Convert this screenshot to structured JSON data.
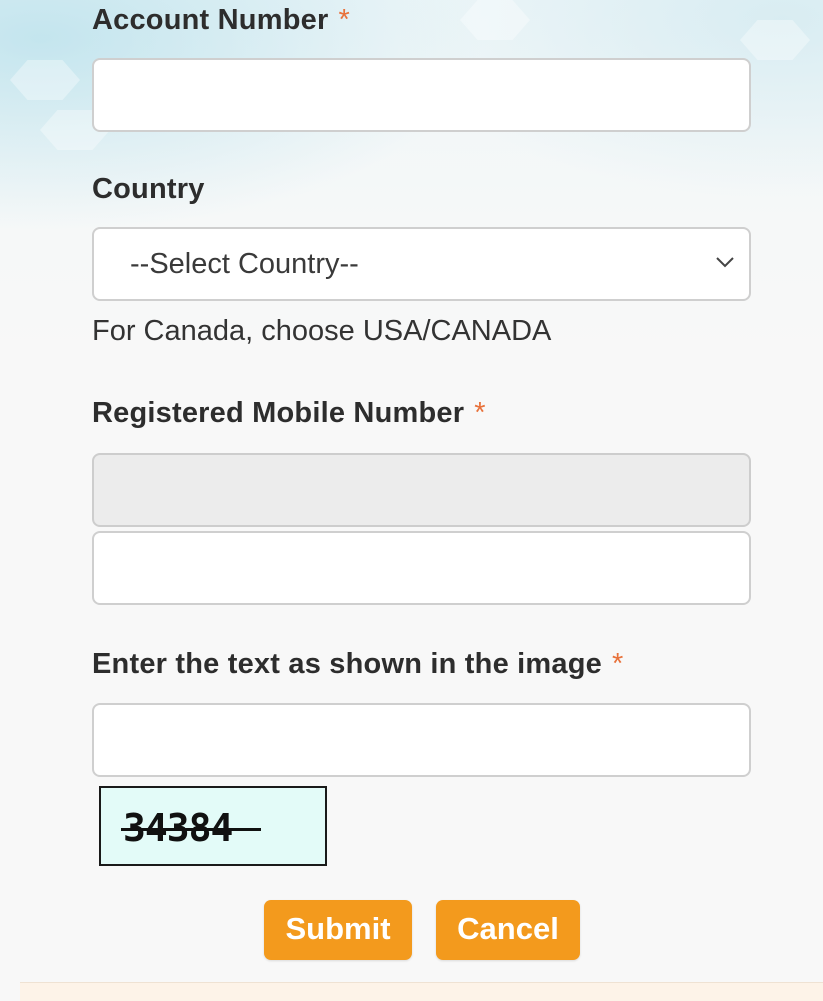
{
  "form": {
    "account_number": {
      "label": "Account Number",
      "required_mark": "*",
      "value": ""
    },
    "country": {
      "label": "Country",
      "selected": "--Select Country--",
      "hint": "For Canada, choose USA/CANADA"
    },
    "mobile": {
      "label": "Registered Mobile Number",
      "required_mark": "*",
      "code_value": "",
      "value": ""
    },
    "captcha": {
      "label": "Enter the text as shown in the image",
      "required_mark": "*",
      "value": "",
      "image_text": "34384"
    }
  },
  "actions": {
    "submit_label": "Submit",
    "cancel_label": "Cancel"
  },
  "colors": {
    "accent": "#f39a1d",
    "required": "#e8713a",
    "captcha_bg": "#e3fbf8"
  },
  "icons": {
    "select_arrow": "chevron-down-icon"
  }
}
